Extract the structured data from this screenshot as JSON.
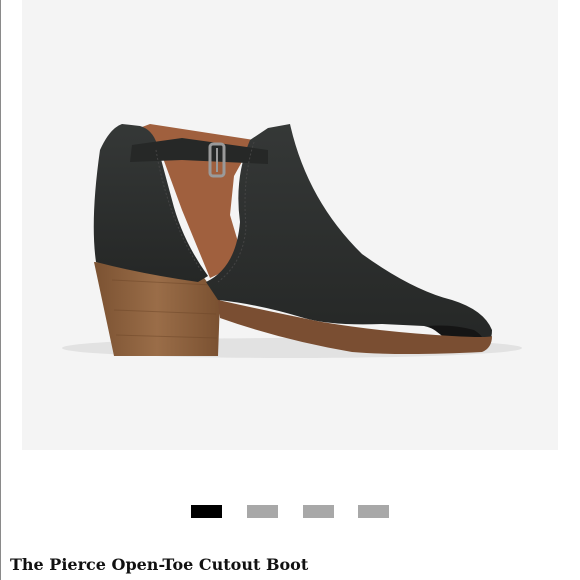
{
  "product": {
    "title": "The Pierce Open-Toe Cutout Boot",
    "image_subject": "black leather open-toe cutout boot with stacked wooden heel"
  },
  "carousel": {
    "slide_count": 4,
    "active_index": 0,
    "active_color": "#000000",
    "inactive_color": "#a8a8a8"
  },
  "colors": {
    "image_background": "#f4f4f4",
    "leather": "#2c2e2d",
    "heel": "#8b6140",
    "lining": "#a0603e"
  }
}
